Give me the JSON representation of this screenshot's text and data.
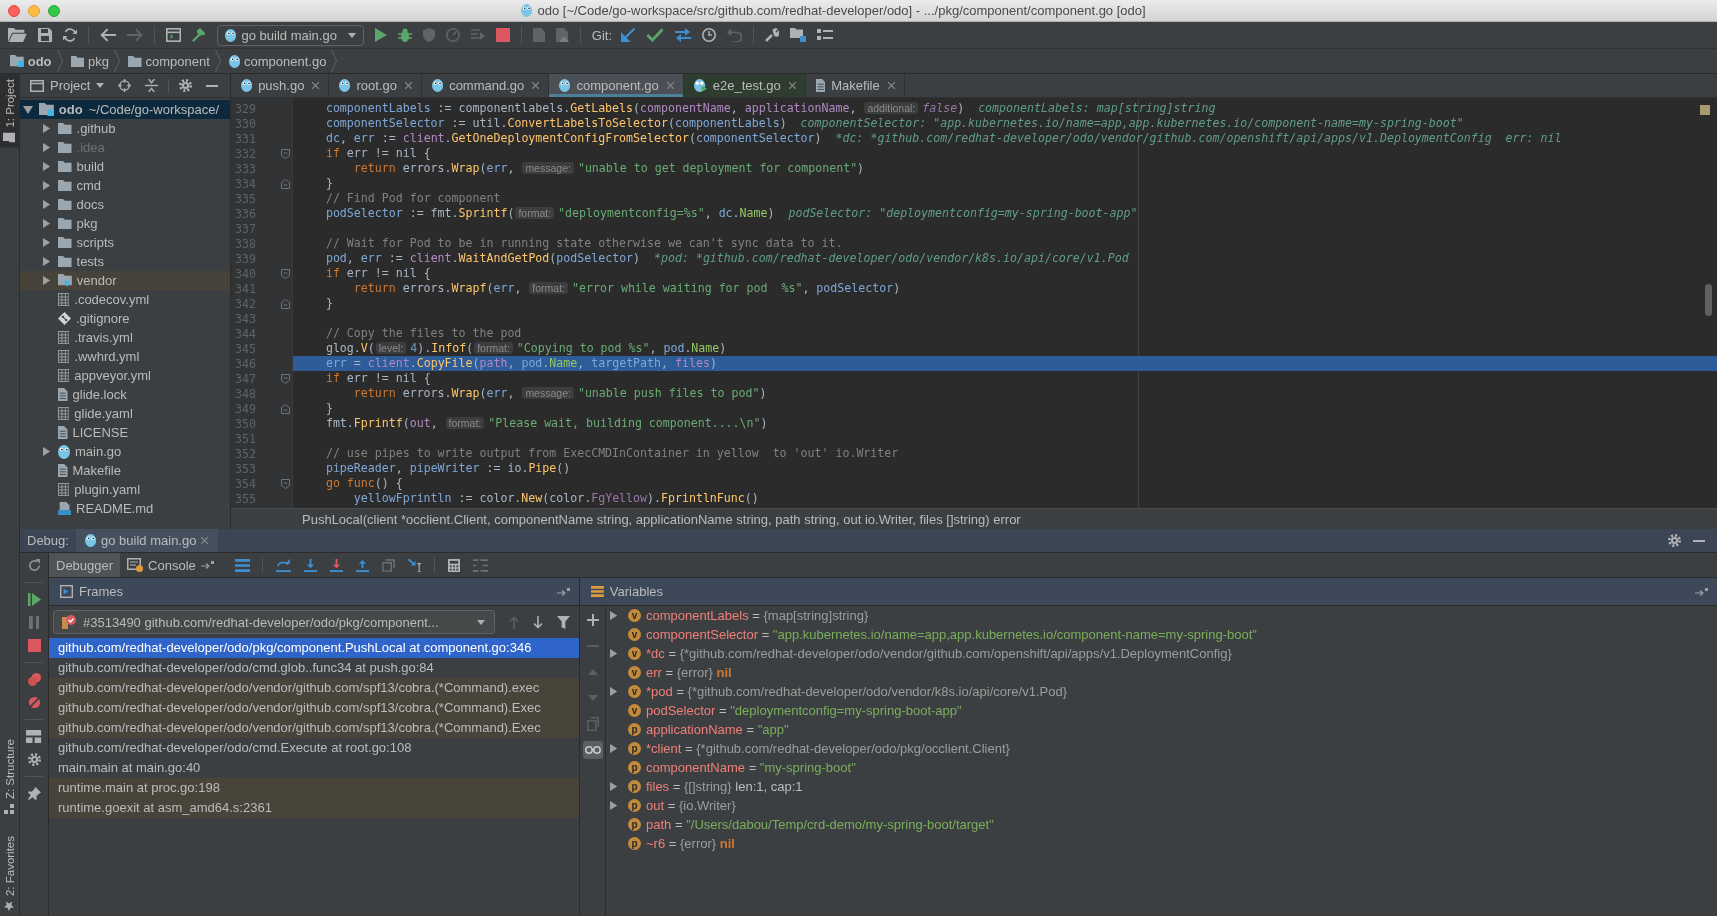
{
  "window": {
    "title": "odo [~/Code/go-workspace/src/github.com/redhat-developer/odo] - .../pkg/component/component.go [odo]"
  },
  "toolbar": {
    "run_config": "go build main.go",
    "vcs_label": "Git:"
  },
  "breadcrumbs": [
    {
      "label": "odo",
      "kind": "module"
    },
    {
      "label": "pkg",
      "kind": "folder"
    },
    {
      "label": "component",
      "kind": "folder"
    },
    {
      "label": "component.go",
      "kind": "go"
    }
  ],
  "tool_stripe": {
    "top": [
      {
        "label": "1: Project",
        "kind": "project",
        "selected": true
      }
    ],
    "bottom": [
      {
        "label": "Z: Structure",
        "kind": "structure",
        "selected": false
      },
      {
        "label": "2: Favorites",
        "kind": "favorites",
        "selected": false
      }
    ]
  },
  "project": {
    "title": "Project",
    "root": {
      "name": "odo",
      "path": "~/Code/go-workspace/",
      "expanded": true,
      "selected": true,
      "children": [
        {
          "name": ".github",
          "kind": "folder",
          "expandable": true,
          "selected": false,
          "ignored": false
        },
        {
          "name": ".idea",
          "kind": "folder",
          "expandable": true,
          "selected": false,
          "ignored": true
        },
        {
          "name": "build",
          "kind": "folder",
          "expandable": true,
          "selected": false,
          "ignored": false
        },
        {
          "name": "cmd",
          "kind": "folder",
          "expandable": true,
          "selected": false,
          "ignored": false
        },
        {
          "name": "docs",
          "kind": "folder",
          "expandable": true,
          "selected": false,
          "ignored": false
        },
        {
          "name": "pkg",
          "kind": "folder",
          "expandable": true,
          "selected": false,
          "ignored": false
        },
        {
          "name": "scripts",
          "kind": "folder",
          "expandable": true,
          "selected": false,
          "ignored": false
        },
        {
          "name": "tests",
          "kind": "folder",
          "expandable": true,
          "selected": false,
          "ignored": false
        },
        {
          "name": "vendor",
          "kind": "library_folder",
          "expandable": true,
          "selected": false,
          "ignored": false
        },
        {
          "name": ".codecov.yml",
          "kind": "yaml",
          "expandable": false,
          "selected": false,
          "ignored": false
        },
        {
          "name": ".gitignore",
          "kind": "git",
          "expandable": false,
          "selected": false,
          "ignored": false
        },
        {
          "name": ".travis.yml",
          "kind": "yaml",
          "expandable": false,
          "selected": false,
          "ignored": false
        },
        {
          "name": ".wwhrd.yml",
          "kind": "yaml",
          "expandable": false,
          "selected": false,
          "ignored": false
        },
        {
          "name": "appveyor.yml",
          "kind": "yaml",
          "expandable": false,
          "selected": false,
          "ignored": false
        },
        {
          "name": "glide.lock",
          "kind": "text",
          "expandable": false,
          "selected": false,
          "ignored": false
        },
        {
          "name": "glide.yaml",
          "kind": "yaml",
          "expandable": false,
          "selected": false,
          "ignored": false
        },
        {
          "name": "LICENSE",
          "kind": "text",
          "expandable": false,
          "selected": false,
          "ignored": false
        },
        {
          "name": "main.go",
          "kind": "go",
          "expandable": true,
          "selected": false,
          "ignored": false
        },
        {
          "name": "Makefile",
          "kind": "text",
          "expandable": false,
          "selected": false,
          "ignored": false
        },
        {
          "name": "plugin.yaml",
          "kind": "yaml",
          "expandable": false,
          "selected": false,
          "ignored": false
        },
        {
          "name": "README.md",
          "kind": "markdown",
          "expandable": false,
          "selected": false,
          "ignored": false
        }
      ]
    }
  },
  "editor": {
    "tabs": [
      {
        "label": "push.go",
        "kind": "go",
        "selected": false
      },
      {
        "label": "root.go",
        "kind": "go",
        "selected": false
      },
      {
        "label": "command.go",
        "kind": "go",
        "selected": false
      },
      {
        "label": "component.go",
        "kind": "go",
        "selected": true
      },
      {
        "label": "e2e_test.go",
        "kind": "go_test",
        "selected": false,
        "color": "#2f3d31"
      },
      {
        "label": "Makefile",
        "kind": "makefile",
        "selected": false
      }
    ],
    "lines": [
      {
        "number": "329",
        "current": false,
        "fold_start": false,
        "fold_end": false,
        "tokens": [
          {
            "text": "componentLabels",
            "kind": "var"
          },
          {
            "text": " := componentlabels.",
            "kind": "plain"
          },
          {
            "text": "GetLabels",
            "kind": "func"
          },
          {
            "text": "(",
            "kind": "plain"
          },
          {
            "text": "componentName",
            "kind": "param"
          },
          {
            "text": ", ",
            "kind": "plain"
          },
          {
            "text": "applicationName",
            "kind": "param"
          },
          {
            "text": ", ",
            "kind": "plain"
          },
          {
            "text": "additional:",
            "kind": "hint"
          },
          {
            "text": "false",
            "kind": "literal"
          },
          {
            "text": ")",
            "kind": "plain"
          }
        ],
        "inline": [
          "componentLabels: map[string]string"
        ]
      },
      {
        "number": "330",
        "current": false,
        "fold_start": false,
        "fold_end": false,
        "tokens": [
          {
            "text": "componentSelector",
            "kind": "var"
          },
          {
            "text": " := util.",
            "kind": "plain"
          },
          {
            "text": "ConvertLabelsToSelector",
            "kind": "func"
          },
          {
            "text": "(",
            "kind": "plain"
          },
          {
            "text": "componentLabels",
            "kind": "var"
          },
          {
            "text": ")",
            "kind": "plain"
          }
        ],
        "inline": [
          "componentSelector: \"app.kubernetes.io/name=app,app.kubernetes.io/component-name=my-spring-boot\""
        ]
      },
      {
        "number": "331",
        "current": false,
        "fold_start": false,
        "fold_end": false,
        "tokens": [
          {
            "text": "dc",
            "kind": "var"
          },
          {
            "text": ", ",
            "kind": "plain"
          },
          {
            "text": "err",
            "kind": "var"
          },
          {
            "text": " := ",
            "kind": "plain"
          },
          {
            "text": "client",
            "kind": "param"
          },
          {
            "text": ".",
            "kind": "plain"
          },
          {
            "text": "GetOneDeploymentConfigFromSelector",
            "kind": "func"
          },
          {
            "text": "(",
            "kind": "plain"
          },
          {
            "text": "componentSelector",
            "kind": "var"
          },
          {
            "text": ")",
            "kind": "plain"
          }
        ],
        "inline": [
          "*dc: *github.com/redhat-developer/odo/vendor/github.com/openshift/api/apps/v1.DeploymentConfig",
          "err: nil"
        ]
      },
      {
        "number": "332",
        "current": false,
        "fold_start": true,
        "fold_end": false,
        "tokens": [
          {
            "text": "if",
            "kind": "keyword"
          },
          {
            "text": " err != nil {",
            "kind": "plain"
          }
        ]
      },
      {
        "number": "333",
        "current": false,
        "fold_start": false,
        "fold_end": false,
        "tokens": [
          {
            "text": "    return",
            "kind": "keyword"
          },
          {
            "text": " errors.",
            "kind": "plain"
          },
          {
            "text": "Wrap",
            "kind": "func"
          },
          {
            "text": "(",
            "kind": "plain"
          },
          {
            "text": "err",
            "kind": "var"
          },
          {
            "text": ", ",
            "kind": "plain"
          },
          {
            "text": "message:",
            "kind": "hint"
          },
          {
            "text": "\"unable to get deployment for component\"",
            "kind": "string"
          },
          {
            "text": ")",
            "kind": "plain"
          }
        ]
      },
      {
        "number": "334",
        "current": false,
        "fold_start": false,
        "fold_end": true,
        "tokens": [
          {
            "text": "}",
            "kind": "plain"
          }
        ]
      },
      {
        "number": "335",
        "current": false,
        "fold_start": false,
        "fold_end": false,
        "tokens": [
          {
            "text": "// Find Pod for component",
            "kind": "comment"
          }
        ]
      },
      {
        "number": "336",
        "current": false,
        "fold_start": false,
        "fold_end": false,
        "tokens": [
          {
            "text": "podSelector",
            "kind": "var"
          },
          {
            "text": " := fmt.",
            "kind": "plain"
          },
          {
            "text": "Sprintf",
            "kind": "func"
          },
          {
            "text": "(",
            "kind": "plain"
          },
          {
            "text": "format:",
            "kind": "hint"
          },
          {
            "text": "\"deploymentconfig=%s\"",
            "kind": "string"
          },
          {
            "text": ", ",
            "kind": "plain"
          },
          {
            "text": "dc",
            "kind": "var"
          },
          {
            "text": ".",
            "kind": "plain"
          },
          {
            "text": "Name",
            "kind": "field"
          },
          {
            "text": ")",
            "kind": "plain"
          }
        ],
        "inline": [
          "podSelector: \"deploymentconfig=my-spring-boot-app\""
        ]
      },
      {
        "number": "337",
        "current": false,
        "fold_start": false,
        "fold_end": false
      },
      {
        "number": "338",
        "current": false,
        "fold_start": false,
        "fold_end": false,
        "tokens": [
          {
            "text": "// Wait for Pod to be in running state otherwise we can't sync data to it.",
            "kind": "comment"
          }
        ]
      },
      {
        "number": "339",
        "current": false,
        "fold_start": false,
        "fold_end": false,
        "tokens": [
          {
            "text": "pod",
            "kind": "var"
          },
          {
            "text": ", ",
            "kind": "plain"
          },
          {
            "text": "err",
            "kind": "var"
          },
          {
            "text": " := ",
            "kind": "plain"
          },
          {
            "text": "client",
            "kind": "param"
          },
          {
            "text": ".",
            "kind": "plain"
          },
          {
            "text": "WaitAndGetPod",
            "kind": "func"
          },
          {
            "text": "(",
            "kind": "plain"
          },
          {
            "text": "podSelector",
            "kind": "var"
          },
          {
            "text": ")",
            "kind": "plain"
          }
        ],
        "inline": [
          "*pod: *github.com/redhat-developer/odo/vendor/k8s.io/api/core/v1.Pod"
        ]
      },
      {
        "number": "340",
        "current": false,
        "fold_start": true,
        "fold_end": false,
        "tokens": [
          {
            "text": "if",
            "kind": "keyword"
          },
          {
            "text": " err != nil {",
            "kind": "plain"
          }
        ]
      },
      {
        "number": "341",
        "current": false,
        "fold_start": false,
        "fold_end": false,
        "tokens": [
          {
            "text": "    return",
            "kind": "keyword"
          },
          {
            "text": " errors.",
            "kind": "plain"
          },
          {
            "text": "Wrapf",
            "kind": "func"
          },
          {
            "text": "(",
            "kind": "plain"
          },
          {
            "text": "err",
            "kind": "var"
          },
          {
            "text": ", ",
            "kind": "plain"
          },
          {
            "text": "format:",
            "kind": "hint"
          },
          {
            "text": "\"error while waiting for pod  %s\"",
            "kind": "string"
          },
          {
            "text": ", ",
            "kind": "plain"
          },
          {
            "text": "podSelector",
            "kind": "var"
          },
          {
            "text": ")",
            "kind": "plain"
          }
        ]
      },
      {
        "number": "342",
        "current": false,
        "fold_start": false,
        "fold_end": true,
        "tokens": [
          {
            "text": "}",
            "kind": "plain"
          }
        ]
      },
      {
        "number": "343",
        "current": false,
        "fold_start": false,
        "fold_end": false
      },
      {
        "number": "344",
        "current": false,
        "fold_start": false,
        "fold_end": false,
        "tokens": [
          {
            "text": "// Copy the files to the pod",
            "kind": "comment"
          }
        ]
      },
      {
        "number": "345",
        "current": false,
        "fold_start": false,
        "fold_end": false,
        "tokens": [
          {
            "text": "glog.",
            "kind": "plain"
          },
          {
            "text": "V",
            "kind": "func"
          },
          {
            "text": "(",
            "kind": "plain"
          },
          {
            "text": "level:",
            "kind": "hint"
          },
          {
            "text": "4",
            "kind": "number"
          },
          {
            "text": ").",
            "kind": "plain"
          },
          {
            "text": "Infof",
            "kind": "func"
          },
          {
            "text": "(",
            "kind": "plain"
          },
          {
            "text": "format:",
            "kind": "hint"
          },
          {
            "text": "\"Copying to pod %s\"",
            "kind": "string"
          },
          {
            "text": ", ",
            "kind": "plain"
          },
          {
            "text": "pod",
            "kind": "var"
          },
          {
            "text": ".",
            "kind": "plain"
          },
          {
            "text": "Name",
            "kind": "field"
          },
          {
            "text": ")",
            "kind": "plain"
          }
        ]
      },
      {
        "number": "346",
        "current": true,
        "fold_start": false,
        "fold_end": false,
        "tokens": [
          {
            "text": "err",
            "kind": "var"
          },
          {
            "text": " = ",
            "kind": "plain"
          },
          {
            "text": "client",
            "kind": "param"
          },
          {
            "text": ".",
            "kind": "plain"
          },
          {
            "text": "CopyFile",
            "kind": "func"
          },
          {
            "text": "(",
            "kind": "plain"
          },
          {
            "text": "path",
            "kind": "param"
          },
          {
            "text": ", ",
            "kind": "plain"
          },
          {
            "text": "pod",
            "kind": "var"
          },
          {
            "text": ".",
            "kind": "plain"
          },
          {
            "text": "Name",
            "kind": "field"
          },
          {
            "text": ", ",
            "kind": "plain"
          },
          {
            "text": "targetPath",
            "kind": "var"
          },
          {
            "text": ", ",
            "kind": "plain"
          },
          {
            "text": "files",
            "kind": "param"
          },
          {
            "text": ")",
            "kind": "plain"
          }
        ]
      },
      {
        "number": "347",
        "current": false,
        "fold_start": true,
        "fold_end": false,
        "tokens": [
          {
            "text": "if",
            "kind": "keyword"
          },
          {
            "text": " err != nil {",
            "kind": "plain"
          }
        ]
      },
      {
        "number": "348",
        "current": false,
        "fold_start": false,
        "fold_end": false,
        "tokens": [
          {
            "text": "    return",
            "kind": "keyword"
          },
          {
            "text": " errors.",
            "kind": "plain"
          },
          {
            "text": "Wrap",
            "kind": "func"
          },
          {
            "text": "(",
            "kind": "plain"
          },
          {
            "text": "err",
            "kind": "var"
          },
          {
            "text": ", ",
            "kind": "plain"
          },
          {
            "text": "message:",
            "kind": "hint"
          },
          {
            "text": "\"unable push files to pod\"",
            "kind": "string"
          },
          {
            "text": ")",
            "kind": "plain"
          }
        ]
      },
      {
        "number": "349",
        "current": false,
        "fold_start": false,
        "fold_end": true,
        "tokens": [
          {
            "text": "}",
            "kind": "plain"
          }
        ]
      },
      {
        "number": "350",
        "current": false,
        "fold_start": false,
        "fold_end": false,
        "tokens": [
          {
            "text": "fmt.",
            "kind": "plain"
          },
          {
            "text": "Fprintf",
            "kind": "func"
          },
          {
            "text": "(",
            "kind": "plain"
          },
          {
            "text": "out",
            "kind": "param"
          },
          {
            "text": ", ",
            "kind": "plain"
          },
          {
            "text": "format:",
            "kind": "hint"
          },
          {
            "text": "\"Please wait, building component....\\n\"",
            "kind": "string"
          },
          {
            "text": ")",
            "kind": "plain"
          }
        ]
      },
      {
        "number": "351",
        "current": false,
        "fold_start": false,
        "fold_end": false
      },
      {
        "number": "352",
        "current": false,
        "fold_start": false,
        "fold_end": false,
        "tokens": [
          {
            "text": "// use pipes to write output from ExecCMDInContainer in yellow  to 'out' io.Writer",
            "kind": "comment"
          }
        ]
      },
      {
        "number": "353",
        "current": false,
        "fold_start": false,
        "fold_end": false,
        "tokens": [
          {
            "text": "pipeReader",
            "kind": "var"
          },
          {
            "text": ", ",
            "kind": "plain"
          },
          {
            "text": "pipeWriter",
            "kind": "var"
          },
          {
            "text": " := io.",
            "kind": "plain"
          },
          {
            "text": "Pipe",
            "kind": "func"
          },
          {
            "text": "()",
            "kind": "plain"
          }
        ]
      },
      {
        "number": "354",
        "current": false,
        "fold_start": true,
        "fold_end": false,
        "tokens": [
          {
            "text": "go func",
            "kind": "keyword"
          },
          {
            "text": "() {",
            "kind": "plain"
          }
        ]
      },
      {
        "number": "355",
        "current": false,
        "fold_start": false,
        "fold_end": false,
        "tokens": [
          {
            "text": "    yellowFprintln",
            "kind": "var"
          },
          {
            "text": " := color.",
            "kind": "plain"
          },
          {
            "text": "New",
            "kind": "func"
          },
          {
            "text": "(color.",
            "kind": "plain"
          },
          {
            "text": "FgYellow",
            "kind": "const"
          },
          {
            "text": ").",
            "kind": "plain"
          },
          {
            "text": "FprintlnFunc",
            "kind": "func"
          },
          {
            "text": "()",
            "kind": "plain"
          }
        ]
      }
    ],
    "parameter_info": "PushLocal(client *occlient.Client, componentName string, applicationName string, path string, out io.Writer, files []string) error"
  },
  "debug": {
    "title": "Debug:",
    "session": "go build main.go",
    "tabs": [
      {
        "label": "Debugger",
        "kind": "debugger",
        "selected": true
      },
      {
        "label": "Console",
        "kind": "console",
        "selected": false
      }
    ],
    "frames": {
      "title": "Frames",
      "thread": "#3513490 github.com/redhat-developer/odo/pkg/component...",
      "items": [
        {
          "text": "github.com/redhat-developer/odo/pkg/component.PushLocal at component.go:346",
          "selected": true,
          "library": false
        },
        {
          "text": "github.com/redhat-developer/odo/cmd.glob..func34 at push.go:84",
          "selected": false,
          "library": false
        },
        {
          "text": "github.com/redhat-developer/odo/vendor/github.com/spf13/cobra.(*Command).exec",
          "selected": false,
          "library": true
        },
        {
          "text": "github.com/redhat-developer/odo/vendor/github.com/spf13/cobra.(*Command).Exec",
          "selected": false,
          "library": true
        },
        {
          "text": "github.com/redhat-developer/odo/vendor/github.com/spf13/cobra.(*Command).Exec",
          "selected": false,
          "library": true
        },
        {
          "text": "github.com/redhat-developer/odo/cmd.Execute at root.go:108",
          "selected": false,
          "library": false
        },
        {
          "text": "main.main at main.go:40",
          "selected": false,
          "library": false
        },
        {
          "text": "runtime.main at proc.go:198",
          "selected": false,
          "library": true
        },
        {
          "text": "runtime.goexit at asm_amd64.s:2361",
          "selected": false,
          "library": true
        }
      ]
    },
    "variables": {
      "title": "Variables",
      "items": [
        {
          "badge": "v",
          "name": "componentLabels",
          "expandable": true,
          "value": [
            {
              "text": "=",
              "kind": "plain"
            },
            {
              "text": "{map[string]string}",
              "kind": "type"
            }
          ]
        },
        {
          "badge": "v",
          "name": "componentSelector",
          "expandable": false,
          "value": [
            {
              "text": "=",
              "kind": "plain"
            },
            {
              "text": "\"app.kubernetes.io/name=app,app.kubernetes.io/component-name=my-spring-boot\"",
              "kind": "string"
            }
          ]
        },
        {
          "badge": "v",
          "name": "*dc",
          "expandable": true,
          "value": [
            {
              "text": "=",
              "kind": "plain"
            },
            {
              "text": "{*github.com/redhat-developer/odo/vendor/github.com/openshift/api/apps/v1.DeploymentConfig}",
              "kind": "type"
            }
          ]
        },
        {
          "badge": "v",
          "name": "err",
          "expandable": false,
          "value": [
            {
              "text": "=",
              "kind": "plain"
            },
            {
              "text": "{error}",
              "kind": "type"
            },
            {
              "text": "nil",
              "kind": "nil"
            }
          ]
        },
        {
          "badge": "v",
          "name": "*pod",
          "expandable": true,
          "value": [
            {
              "text": "=",
              "kind": "plain"
            },
            {
              "text": "{*github.com/redhat-developer/odo/vendor/k8s.io/api/core/v1.Pod}",
              "kind": "type"
            }
          ]
        },
        {
          "badge": "v",
          "name": "podSelector",
          "expandable": false,
          "value": [
            {
              "text": "=",
              "kind": "plain"
            },
            {
              "text": "\"deploymentconfig=my-spring-boot-app\"",
              "kind": "string"
            }
          ]
        },
        {
          "badge": "p",
          "name": "applicationName",
          "expandable": false,
          "value": [
            {
              "text": "=",
              "kind": "plain"
            },
            {
              "text": "\"app\"",
              "kind": "string"
            }
          ]
        },
        {
          "badge": "p",
          "name": "*client",
          "expandable": true,
          "value": [
            {
              "text": "=",
              "kind": "plain"
            },
            {
              "text": "{*github.com/redhat-developer/odo/pkg/occlient.Client}",
              "kind": "type"
            }
          ]
        },
        {
          "badge": "p",
          "name": "componentName",
          "expandable": false,
          "value": [
            {
              "text": "=",
              "kind": "plain"
            },
            {
              "text": "\"my-spring-boot\"",
              "kind": "string"
            }
          ]
        },
        {
          "badge": "p",
          "name": "files",
          "expandable": true,
          "value": [
            {
              "text": "=",
              "kind": "plain"
            },
            {
              "text": "{[]string}",
              "kind": "type"
            },
            {
              "text": "len:1, cap:1",
              "kind": "plain"
            }
          ]
        },
        {
          "badge": "p",
          "name": "out",
          "expandable": true,
          "value": [
            {
              "text": "=",
              "kind": "plain"
            },
            {
              "text": "{io.Writer}",
              "kind": "type"
            }
          ]
        },
        {
          "badge": "p",
          "name": "path",
          "expandable": false,
          "value": [
            {
              "text": "=",
              "kind": "plain"
            },
            {
              "text": "\"/Users/dabou/Temp/crd-demo/my-spring-boot/target\"",
              "kind": "string"
            }
          ]
        },
        {
          "badge": "p",
          "name": "~r6",
          "expandable": false,
          "value": [
            {
              "text": "=",
              "kind": "plain"
            },
            {
              "text": "{error}",
              "kind": "type"
            },
            {
              "text": "nil",
              "kind": "nil"
            }
          ]
        }
      ]
    }
  }
}
